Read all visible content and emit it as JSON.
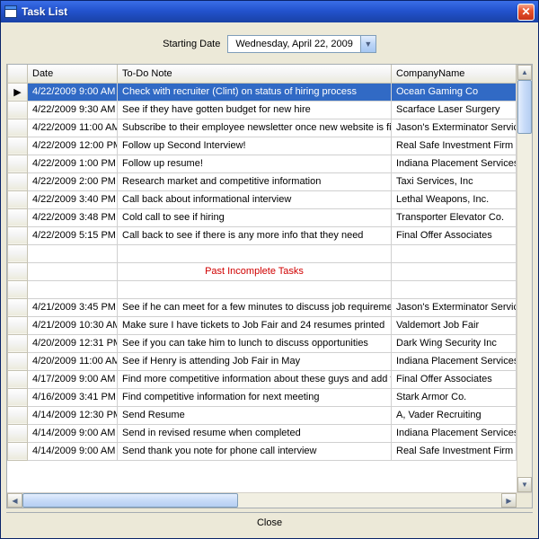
{
  "window": {
    "title": "Task List"
  },
  "dateRow": {
    "label": "Starting Date",
    "value": "Wednesday,     April    22, 2009"
  },
  "columns": {
    "date": "Date",
    "note": "To-Do Note",
    "company": "CompanyName"
  },
  "sectionLabel": "Past Incomplete Tasks",
  "rows": [
    {
      "kind": "data",
      "selected": true,
      "marker": "▶",
      "date": "4/22/2009 9:00 AM",
      "note": "Check with recruiter (Clint) on status of hiring process",
      "company": "Ocean Gaming Co"
    },
    {
      "kind": "data",
      "date": "4/22/2009 9:30 AM",
      "note": "See if they have gotten budget for new hire",
      "company": "Scarface Laser Surgery"
    },
    {
      "kind": "data",
      "date": "4/22/2009 11:00 AM",
      "note": "Subscribe to their employee newsletter once new website is finished",
      "company": "Jason's Exterminator Service"
    },
    {
      "kind": "data",
      "date": "4/22/2009 12:00 PM",
      "note": "Follow up Second Interview!",
      "company": "Real Safe Investment Firm"
    },
    {
      "kind": "data",
      "date": "4/22/2009 1:00 PM",
      "note": "Follow up resume!",
      "company": "Indiana Placement Services"
    },
    {
      "kind": "data",
      "date": "4/22/2009 2:00 PM",
      "note": "Research market and competitive information",
      "company": "Taxi Services, Inc"
    },
    {
      "kind": "data",
      "date": "4/22/2009 3:40 PM",
      "note": "Call back about informational interview",
      "company": "Lethal Weapons, Inc."
    },
    {
      "kind": "data",
      "date": "4/22/2009 3:48 PM",
      "note": "Cold call to see if hiring",
      "company": "Transporter Elevator Co."
    },
    {
      "kind": "data",
      "date": "4/22/2009 5:15 PM",
      "note": "Call back to see if there is any more info that they need",
      "company": "Final Offer Associates"
    },
    {
      "kind": "blank"
    },
    {
      "kind": "section"
    },
    {
      "kind": "blank"
    },
    {
      "kind": "data",
      "date": "4/21/2009 3:45 PM",
      "note": "See if he can meet for a few minutes to discuss job requirements",
      "company": "Jason's Exterminator Service"
    },
    {
      "kind": "data",
      "date": "4/21/2009 10:30 AM",
      "note": "Make sure I have tickets to Job Fair and 24 resumes printed",
      "company": "Valdemort Job Fair"
    },
    {
      "kind": "data",
      "date": "4/20/2009 12:31 PM",
      "note": "See if you can take him to lunch to discuss opportunities",
      "company": "Dark Wing Security Inc"
    },
    {
      "kind": "data",
      "date": "4/20/2009 11:00 AM",
      "note": "See if Henry is attending Job Fair in May",
      "company": "Indiana Placement Services"
    },
    {
      "kind": "data",
      "date": "4/17/2009 9:00 AM",
      "note": "Find more competitive information about these guys and add to notes",
      "company": "Final Offer Associates"
    },
    {
      "kind": "data",
      "date": "4/16/2009 3:41 PM",
      "note": "Find competitive information for next meeting",
      "company": "Stark Armor Co."
    },
    {
      "kind": "data",
      "date": "4/14/2009 12:30 PM",
      "note": "Send Resume",
      "company": "A, Vader Recruiting"
    },
    {
      "kind": "data",
      "date": "4/14/2009 9:00 AM",
      "note": "Send in revised resume when completed",
      "company": "Indiana Placement Services"
    },
    {
      "kind": "data",
      "date": "4/14/2009 9:00 AM",
      "note": "Send thank you note for phone call interview",
      "company": "Real Safe Investment Firm"
    }
  ],
  "footer": {
    "close": "Close"
  }
}
